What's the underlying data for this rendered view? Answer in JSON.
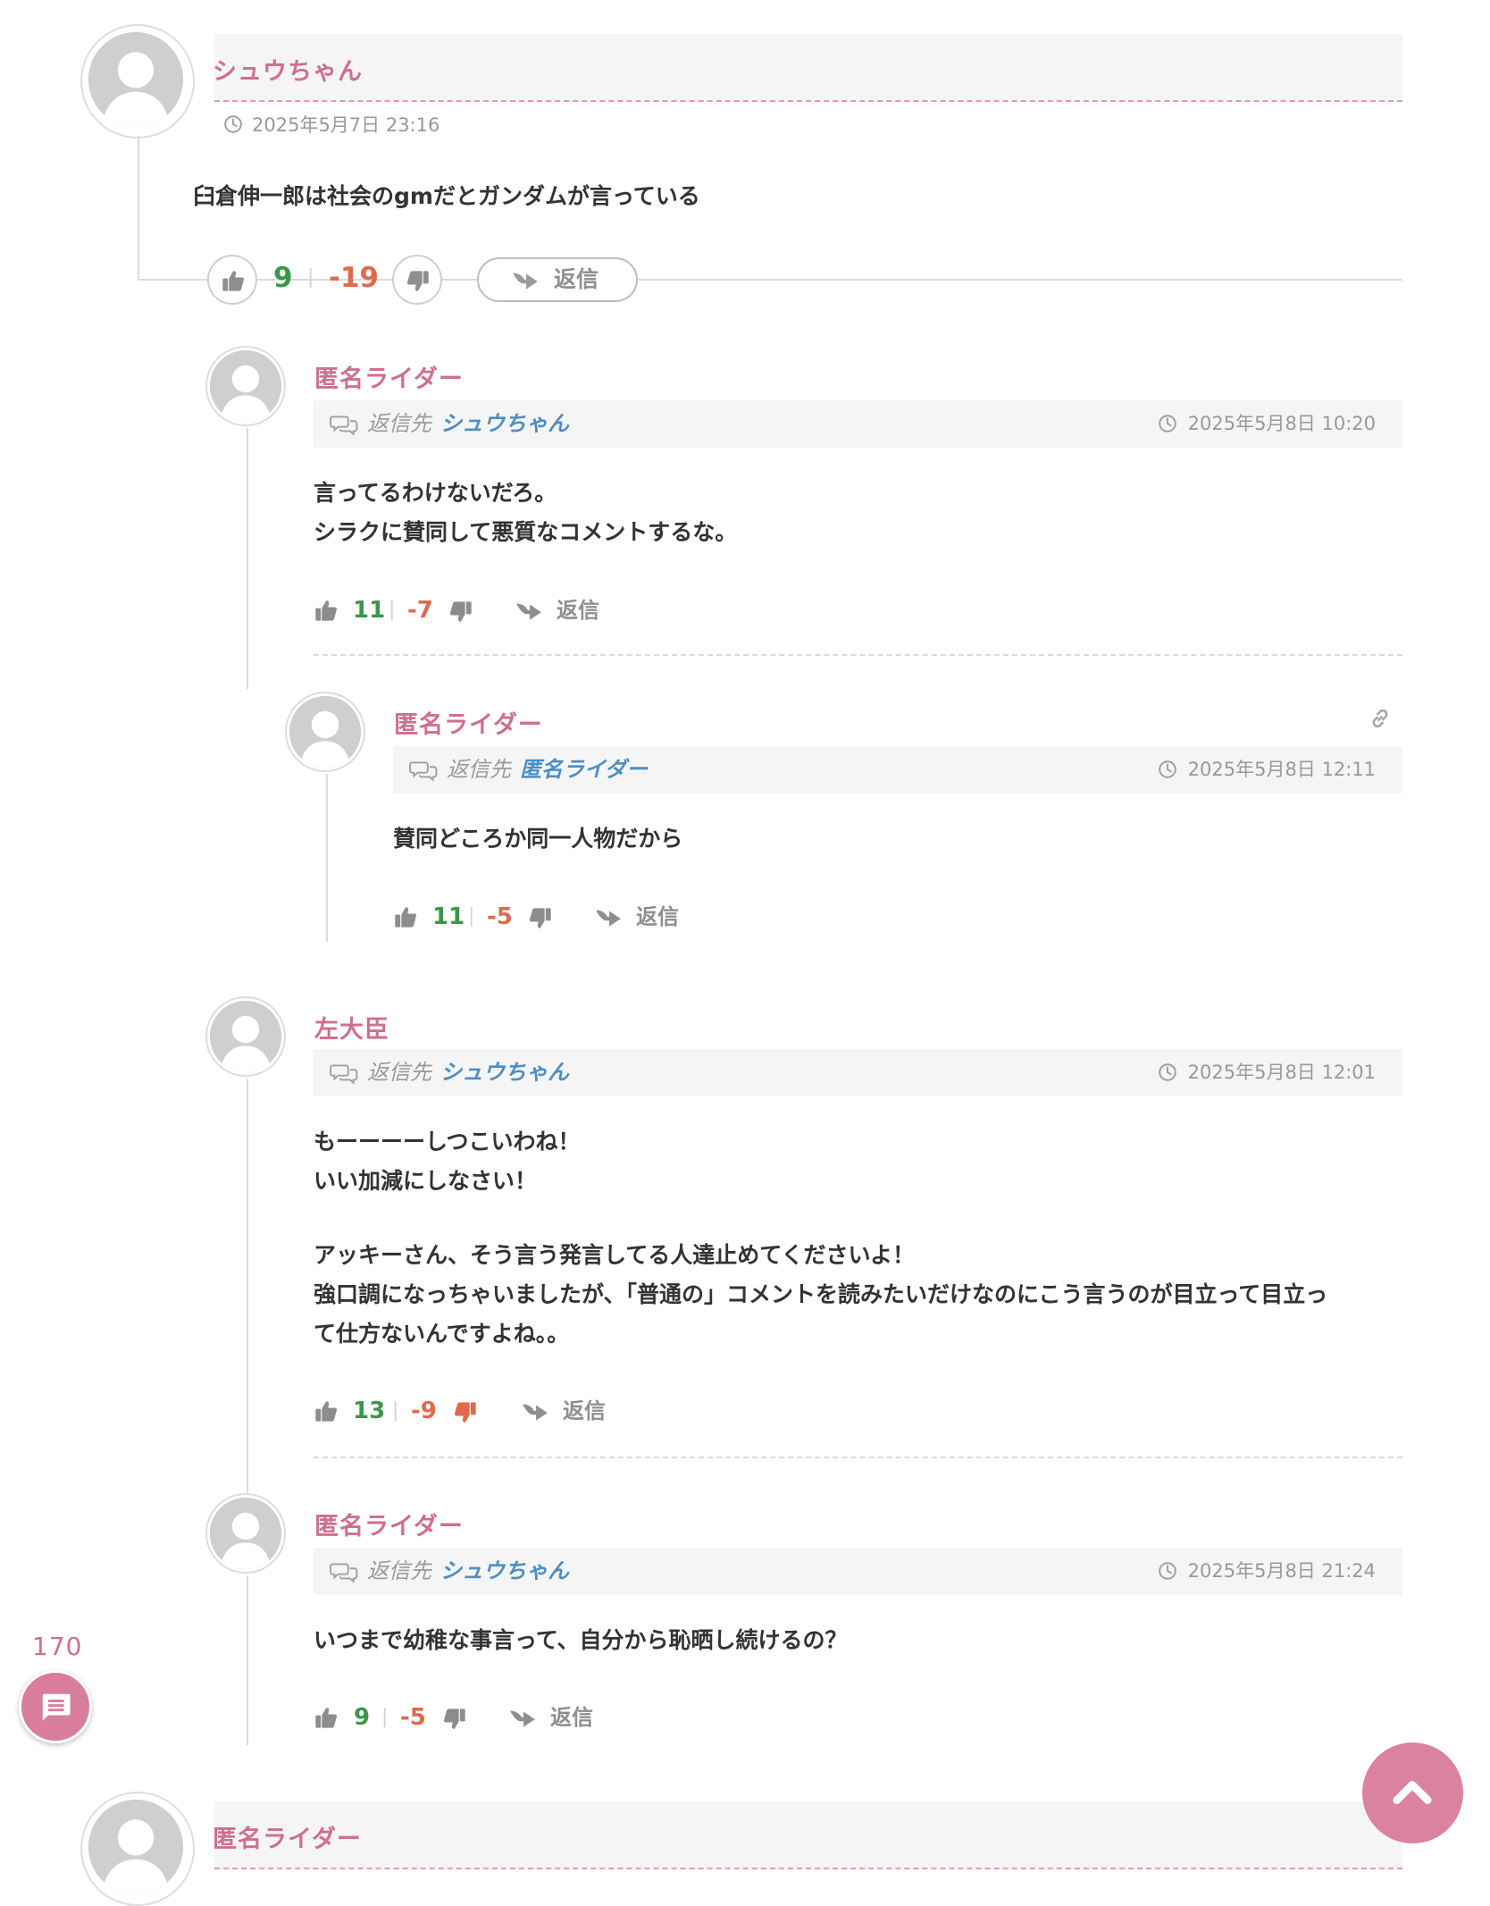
{
  "comments": [
    {
      "author": "シュウちゃん",
      "date": "2025年5月7日 23:16",
      "body": [
        "臼倉伸一郎は社会のgmだとガンダムが言っている"
      ],
      "likes": "9",
      "dislikes": "-19",
      "reply_label": "返信"
    },
    {
      "author": "匿名ライダー",
      "reply_to_prefix": "返信先",
      "reply_to": "シュウちゃん",
      "date": "2025年5月8日 10:20",
      "body": [
        "言ってるわけないだろ。",
        "シラクに賛同して悪質なコメントするな。"
      ],
      "likes": "11",
      "dislikes": "-7",
      "reply_label": "返信"
    },
    {
      "author": "匿名ライダー",
      "reply_to_prefix": "返信先",
      "reply_to": "匿名ライダー",
      "date": "2025年5月8日 12:11",
      "body": [
        "賛同どころか同一人物だから"
      ],
      "likes": "11",
      "dislikes": "-5",
      "reply_label": "返信"
    },
    {
      "author": "左大臣",
      "reply_to_prefix": "返信先",
      "reply_to": "シュウちゃん",
      "date": "2025年5月8日 12:01",
      "body": [
        "もーーーーしつこいわね！",
        "いい加減にしなさい！",
        "",
        "アッキーさん、そう言う発言してる人達止めてくださいよ！",
        "強口調になっちゃいましたが、「普通の」コメントを読みたいだけなのにこう言うのが目立って目立っ",
        "て仕方ないんですよね。。"
      ],
      "likes": "13",
      "dislikes": "-9",
      "reply_label": "返信"
    },
    {
      "author": "匿名ライダー",
      "reply_to_prefix": "返信先",
      "reply_to": "シュウちゃん",
      "date": "2025年5月8日 21:24",
      "body": [
        "いつまで幼稚な事言って、自分から恥晒し続けるの？"
      ],
      "likes": "9",
      "dislikes": "-5",
      "reply_label": "返信"
    },
    {
      "author": "匿名ライダー"
    }
  ],
  "comment_count": "170",
  "icons": {
    "clock": "clock-icon",
    "thumb_up": "thumbs-up-icon",
    "thumb_down": "thumbs-down-icon",
    "reply_arrow": "reply-arrow-icon",
    "reply_to": "speech-bubbles-icon",
    "link": "link-icon",
    "comments_fab": "message-icon",
    "scroll_top": "chevron-up-icon"
  },
  "colors": {
    "accent_pink": "#cf6f8f",
    "reply_to_blue": "#4c8fc6",
    "like_green": "#3b9748",
    "dislike_red": "#e06a4a"
  }
}
